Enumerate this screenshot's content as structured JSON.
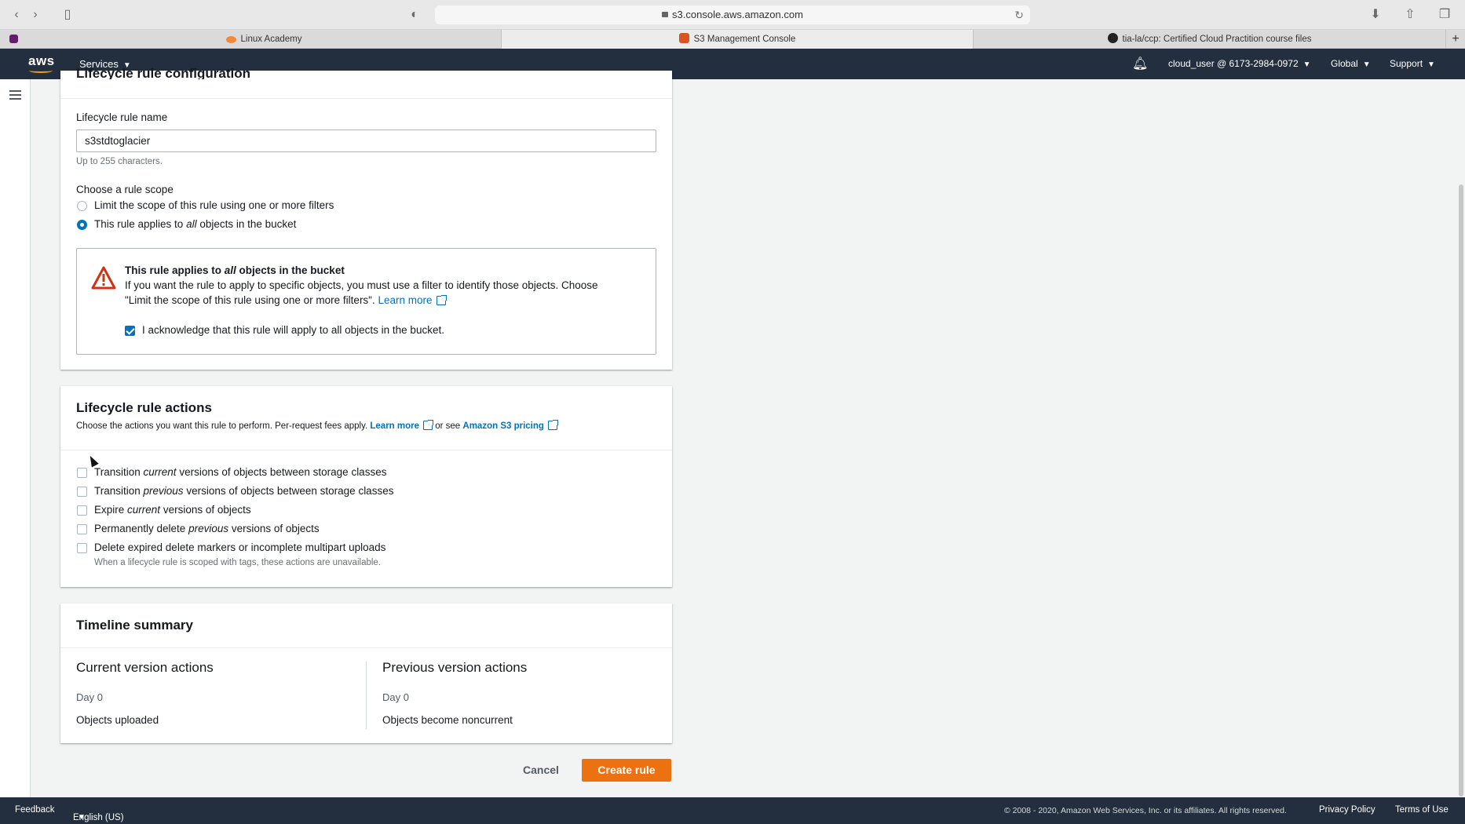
{
  "browser": {
    "url": "s3.console.aws.amazon.com",
    "tabs": [
      {
        "label": "Linux Academy"
      },
      {
        "label": "S3 Management Console"
      },
      {
        "label": "tia-la/ccp: Certified Cloud Practition course files"
      }
    ]
  },
  "aws_nav": {
    "logo": "aws",
    "services": "Services",
    "account": "cloud_user @ 6173-2984-0972",
    "region": "Global",
    "support": "Support"
  },
  "config": {
    "partial_heading": "Lifecycle rule configuration",
    "name_label": "Lifecycle rule name",
    "name_value": "s3stdtoglacier",
    "name_hint": "Up to 255 characters.",
    "scope_label": "Choose a rule scope",
    "scope_options": [
      {
        "pre": "Limit the scope of this rule using one or more filters",
        "em": "",
        "post": "",
        "selected": false
      },
      {
        "pre": "This rule applies to ",
        "em": "all",
        "post": " objects in the bucket",
        "selected": true
      }
    ],
    "warning": {
      "title_pre": "This rule applies to ",
      "title_em": "all",
      "title_post": " objects in the bucket",
      "line1": "If you want the rule to apply to specific objects, you must use a filter to identify those objects. Choose",
      "line2": "\"Limit the scope of this rule using one or more filters\".",
      "learn_more": "Learn more",
      "ack": "I acknowledge that this rule will apply to all objects in the bucket.",
      "ack_checked": true
    }
  },
  "actions": {
    "heading": "Lifecycle rule actions",
    "desc_pre": "Choose the actions you want this rule to perform. Per-request fees apply.",
    "learn_more": "Learn more",
    "or_see": "or see",
    "pricing": "Amazon S3 pricing",
    "options": [
      {
        "pre": "Transition ",
        "em": "current",
        "post": " versions of objects between storage classes"
      },
      {
        "pre": "Transition ",
        "em": "previous",
        "post": " versions of objects between storage classes"
      },
      {
        "pre": "Expire ",
        "em": "current",
        "post": " versions of objects"
      },
      {
        "pre": "Permanently delete ",
        "em": "previous",
        "post": " versions of objects"
      },
      {
        "pre": "Delete expired delete markers or incomplete multipart uploads",
        "em": "",
        "post": ""
      }
    ],
    "note": "When a lifecycle rule is scoped with tags, these actions are unavailable."
  },
  "timeline": {
    "heading": "Timeline summary",
    "current": {
      "heading": "Current version actions",
      "day": "Day 0",
      "event": "Objects uploaded"
    },
    "previous": {
      "heading": "Previous version actions",
      "day": "Day 0",
      "event": "Objects become noncurrent"
    }
  },
  "buttons": {
    "cancel": "Cancel",
    "create": "Create rule"
  },
  "footer": {
    "feedback": "Feedback",
    "language": "English (US)",
    "copyright": "© 2008 - 2020, Amazon Web Services, Inc. or its affiliates. All rights reserved.",
    "privacy": "Privacy Policy",
    "terms": "Terms of Use"
  },
  "colors": {
    "aws_nav": "#232f3e",
    "link": "#0073bb",
    "primary_button": "#ec7211",
    "warning": "#d13212"
  }
}
